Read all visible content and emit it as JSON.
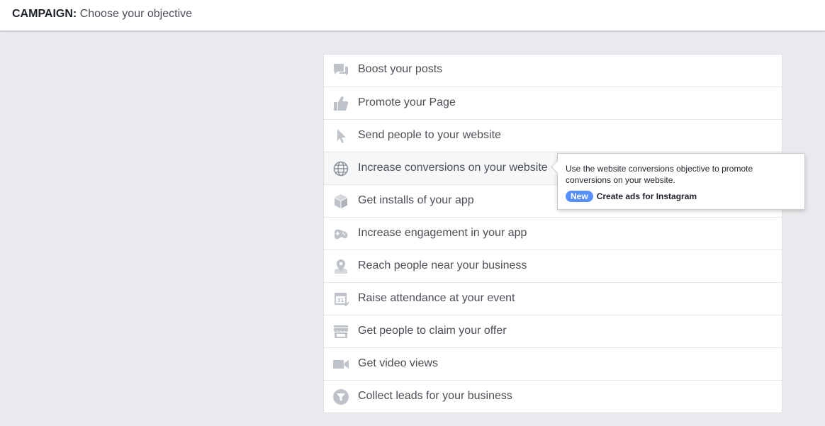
{
  "header": {
    "label": "CAMPAIGN:",
    "subtitle": "Choose your objective"
  },
  "objectives": [
    {
      "icon": "chat-bubbles-icon",
      "label": "Boost your posts"
    },
    {
      "icon": "thumbs-up-icon",
      "label": "Promote your Page"
    },
    {
      "icon": "cursor-icon",
      "label": "Send people to your website"
    },
    {
      "icon": "globe-icon",
      "label": "Increase conversions on your website"
    },
    {
      "icon": "box-icon",
      "label": "Get installs of your app"
    },
    {
      "icon": "gamepad-icon",
      "label": "Increase engagement in your app"
    },
    {
      "icon": "map-pin-icon",
      "label": "Reach people near your business"
    },
    {
      "icon": "calendar-icon",
      "label": "Raise attendance at your event"
    },
    {
      "icon": "storefront-icon",
      "label": "Get people to claim your offer"
    },
    {
      "icon": "video-camera-icon",
      "label": "Get video views"
    },
    {
      "icon": "funnel-icon",
      "label": "Collect leads for your business"
    }
  ],
  "tooltip": {
    "description": "Use the website conversions objective to promote conversions on your website.",
    "badge": "New",
    "link": "Create ads for Instagram"
  },
  "colors": {
    "background": "#e9eaed",
    "icon": "#bec3c9",
    "badge": "#5890ff",
    "text": "#4b4f56"
  }
}
